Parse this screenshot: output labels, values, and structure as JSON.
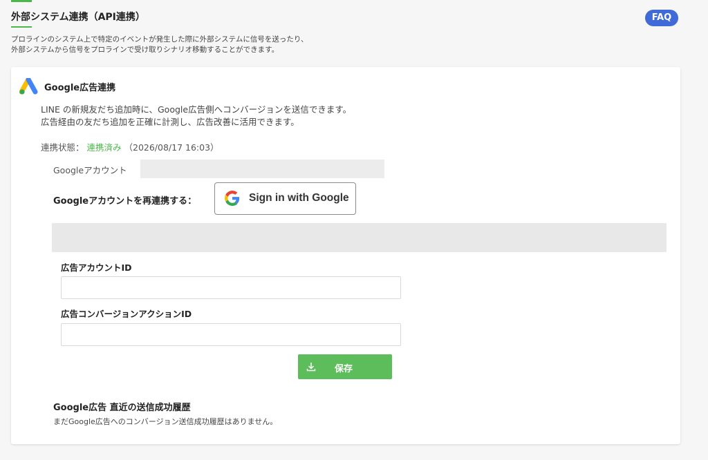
{
  "header": {
    "title": "外部システム連携（API連携）",
    "faq_label": "FAQ",
    "description_line1": "プロラインのシステム上で特定のイベントが発生した際に外部システムに信号を送ったり、",
    "description_line2": "外部システムから信号をプロラインで受け取りシナリオ移動することができます。"
  },
  "card": {
    "title": "Google広告連携",
    "intro_line1": "LINE の新規友だち追加時に、Google広告側へコンバージョンを送信できます。",
    "intro_line2": "広告経由の友だち追加を正確に計測し、広告改善に活用できます。",
    "status_label": "連携状態：",
    "status_value": "連携済み",
    "status_timestamp": "（2026/08/17 16:03）",
    "account_label": "Googleアカウント",
    "account_value": "",
    "relink_label": "Googleアカウントを再連携する：",
    "signin_button": "Sign in with Google",
    "ad_account_label": "広告アカウントID",
    "ad_account_value": "",
    "conversion_label": "広告コンバージョンアクションID",
    "conversion_value": "",
    "save_label": "保存",
    "history_title": "Google広告 直近の送信成功履歴",
    "history_empty": "まだGoogle広告へのコンバージョン送信成功履歴はありません。"
  },
  "colors": {
    "accent_green": "#4cb749",
    "save_green": "#5cbd5a",
    "faq_blue": "#3f6ad8"
  },
  "icons": [
    "google-ads-logo-icon",
    "google-g-icon",
    "download-icon"
  ]
}
